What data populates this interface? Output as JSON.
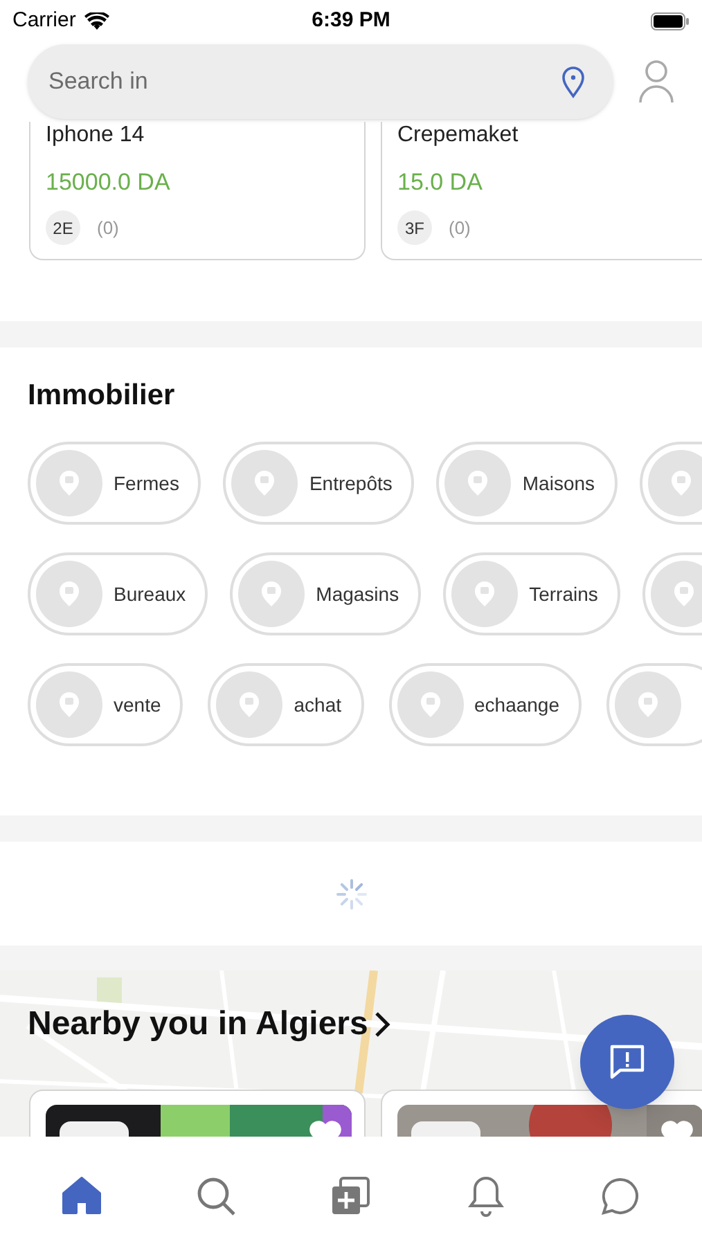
{
  "status_bar": {
    "carrier": "Carrier",
    "time": "6:39 PM"
  },
  "search": {
    "placeholder": "Search in"
  },
  "products": [
    {
      "title": "Iphone 14",
      "price": "15000.0 DA",
      "badge": "2E",
      "count": "(0)"
    },
    {
      "title": "Crepemaket",
      "price": "15.0 DA",
      "badge": "3F",
      "count": "(0)"
    }
  ],
  "section": {
    "title": "Immobilier"
  },
  "category_rows": [
    [
      {
        "label": "Fermes"
      },
      {
        "label": "Entrepôts"
      },
      {
        "label": "Maisons"
      },
      {}
    ],
    [
      {
        "label": "Bureaux"
      },
      {
        "label": "Magasins"
      },
      {
        "label": "Terrains"
      },
      {}
    ],
    [
      {
        "label": "vente"
      },
      {
        "label": "achat"
      },
      {
        "label": "echaange"
      },
      {}
    ]
  ],
  "nearby": {
    "title": "Nearby you in Algiers"
  },
  "tab_bar": [
    {
      "selected": true
    },
    {
      "selected": false
    },
    {
      "selected": false
    },
    {
      "selected": false
    },
    {
      "selected": false
    }
  ]
}
